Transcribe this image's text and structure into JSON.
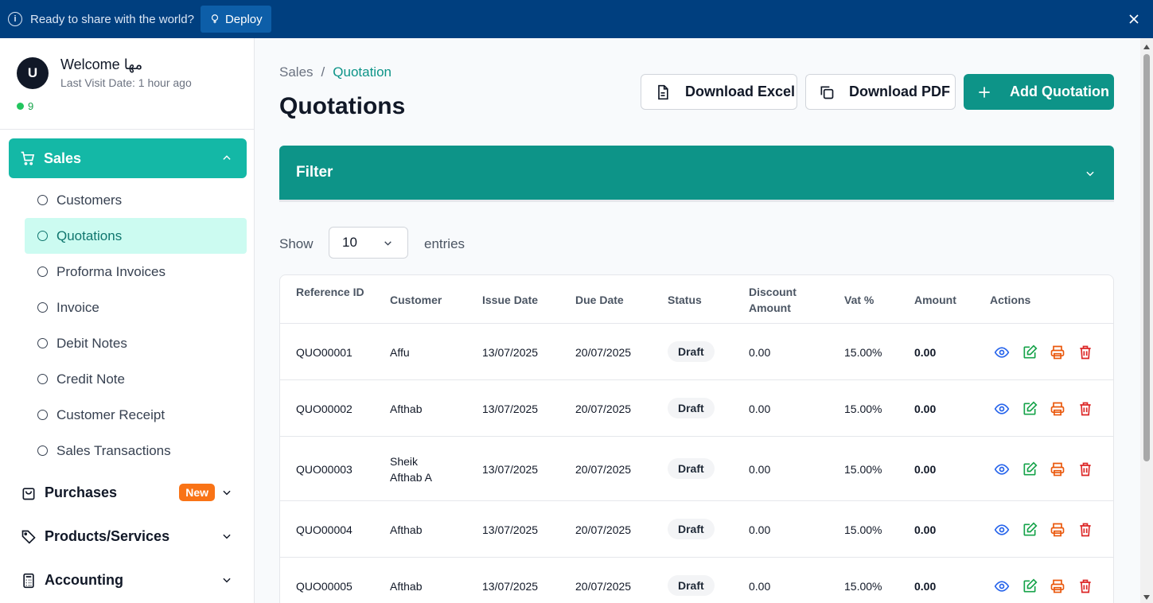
{
  "banner": {
    "text": "Ready to share with the world?",
    "deploy_label": "Deploy"
  },
  "profile": {
    "avatar_initial": "U",
    "welcome": "Welcome مها",
    "last_visit": "Last Visit Date: 1 hour ago",
    "online_count": "9"
  },
  "sidebar": {
    "sales_label": "Sales",
    "sales_items": [
      "Customers",
      "Quotations",
      "Proforma Invoices",
      "Invoice",
      "Debit Notes",
      "Credit Note",
      "Customer Receipt",
      "Sales Transactions"
    ],
    "active_item": "Quotations",
    "purchases_label": "Purchases",
    "purchases_badge": "New",
    "products_label": "Products/Services",
    "accounting_label": "Accounting"
  },
  "breadcrumb": {
    "parent": "Sales",
    "separator": "/",
    "current": "Quotation"
  },
  "page_title": "Quotations",
  "toolbar": {
    "excel_label": "Download Excel",
    "pdf_label": "Download PDF",
    "add_label": "Add Quotation"
  },
  "filter": {
    "label": "Filter"
  },
  "entries": {
    "show_label": "Show",
    "value": "10",
    "entries_label": "entries"
  },
  "table": {
    "headers": [
      "Reference ID",
      "Customer",
      "Issue Date",
      "Due Date",
      "Status",
      "Discount Amount",
      "Vat %",
      "Amount",
      "Actions"
    ],
    "rows": [
      {
        "ref": "QUO00001",
        "customer": "Affu",
        "issue": "13/07/2025",
        "due": "20/07/2025",
        "status": "Draft",
        "discount": "0.00",
        "vat": "15.00%",
        "amount": "0.00"
      },
      {
        "ref": "QUO00002",
        "customer": "Afthab",
        "issue": "13/07/2025",
        "due": "20/07/2025",
        "status": "Draft",
        "discount": "0.00",
        "vat": "15.00%",
        "amount": "0.00"
      },
      {
        "ref": "QUO00003",
        "customer": "Sheik Afthab A",
        "issue": "13/07/2025",
        "due": "20/07/2025",
        "status": "Draft",
        "discount": "0.00",
        "vat": "15.00%",
        "amount": "0.00"
      },
      {
        "ref": "QUO00004",
        "customer": "Afthab",
        "issue": "13/07/2025",
        "due": "20/07/2025",
        "status": "Draft",
        "discount": "0.00",
        "vat": "15.00%",
        "amount": "0.00"
      },
      {
        "ref": "QUO00005",
        "customer": "Afthab",
        "issue": "13/07/2025",
        "due": "20/07/2025",
        "status": "Draft",
        "discount": "0.00",
        "vat": "15.00%",
        "amount": "0.00"
      }
    ]
  },
  "colors": {
    "banner": "#003f7f",
    "accent": "#0d9488",
    "sales_active": "#14b8a6",
    "view": "#2563eb",
    "edit": "#16a34a",
    "print": "#ea580c",
    "delete": "#dc2626"
  },
  "icons": {
    "view": "eye-icon",
    "edit": "edit-icon",
    "print": "printer-icon",
    "delete": "trash-icon"
  }
}
